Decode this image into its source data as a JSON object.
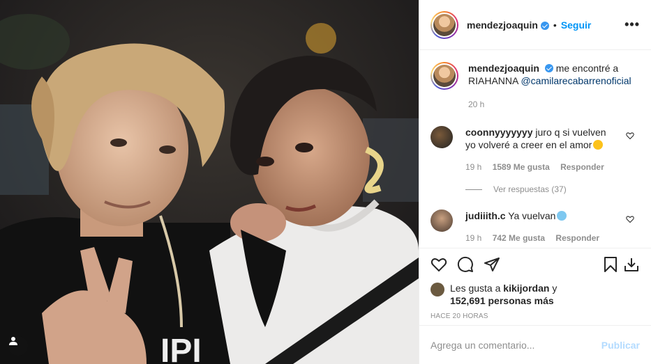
{
  "header": {
    "username": "mendezjoaquin",
    "separator": "•",
    "follow_label": "Seguir",
    "more_label": "•••"
  },
  "caption": {
    "username": "mendezjoaquin",
    "text": "me encontré a RIAHANNA",
    "mention": "@camilarecabarrenoficial",
    "time": "20 h"
  },
  "comments": [
    {
      "username": "coonnyyyyyyy",
      "text": "juro q si vuelven yo volveré a creer en el amor",
      "time": "19 h",
      "likes": "1589 Me gusta",
      "reply_label": "Responder",
      "view_replies": "Ver respuestas (37)"
    },
    {
      "username": "judiiith.c",
      "text": "Ya vuelvan",
      "time": "19 h",
      "likes": "742 Me gusta",
      "reply_label": "Responder"
    }
  ],
  "likes": {
    "prefix": "Les gusta a",
    "user": "kikijordan",
    "middle": "y",
    "count": "152,691 personas más"
  },
  "timestamp": "HACE 20 HORAS",
  "add_comment": {
    "placeholder": "Agrega un comentario...",
    "post_label": "Publicar"
  },
  "colors": {
    "accent": "#0095f6",
    "verified": "#3897f0",
    "muted": "#8e8e8e",
    "post_disabled": "#b3dbff"
  },
  "icons": [
    "user-tag-icon",
    "verified-icon",
    "more-icon",
    "heart-icon",
    "comment-icon",
    "share-icon",
    "bookmark-icon",
    "download-icon",
    "heart-small-icon"
  ]
}
